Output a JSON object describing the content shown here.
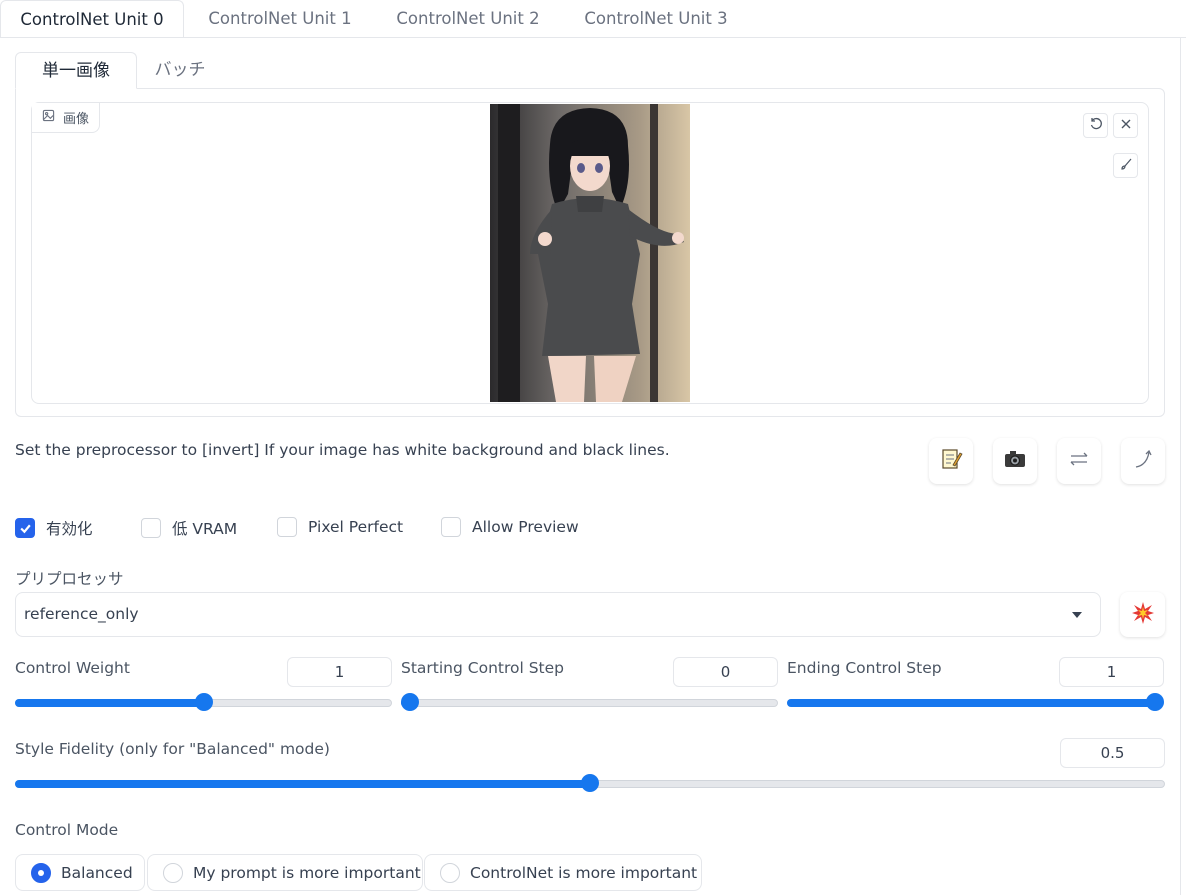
{
  "unit_tabs": [
    {
      "label": "ControlNet Unit 0",
      "active": true
    },
    {
      "label": "ControlNet Unit 1",
      "active": false
    },
    {
      "label": "ControlNet Unit 2",
      "active": false
    },
    {
      "label": "ControlNet Unit 3",
      "active": false
    }
  ],
  "mode_tabs": [
    {
      "label": "単一画像",
      "active": true
    },
    {
      "label": "バッチ",
      "active": false
    }
  ],
  "image_panel": {
    "label": "画像",
    "icons": [
      "undo-icon",
      "close-icon",
      "brush-icon"
    ]
  },
  "hint_text": "Set the preprocessor to [invert] If your image has white background and black lines.",
  "action_buttons": [
    "notepad-icon",
    "camera-icon",
    "swap-icon",
    "send-arrow-icon"
  ],
  "checkboxes": [
    {
      "label": "有効化",
      "checked": true
    },
    {
      "label": "低 VRAM",
      "checked": false
    },
    {
      "label": "Pixel Perfect",
      "checked": false
    },
    {
      "label": "Allow Preview",
      "checked": false
    }
  ],
  "preprocessor": {
    "label": "プリプロセッサ",
    "value": "reference_only",
    "run_icon": "explosion-icon"
  },
  "sliders": {
    "control_weight": {
      "label": "Control Weight",
      "value": "1",
      "min": 0,
      "max": 2,
      "current": 1
    },
    "starting_step": {
      "label": "Starting Control Step",
      "value": "0",
      "min": 0,
      "max": 1,
      "current": 0
    },
    "ending_step": {
      "label": "Ending Control Step",
      "value": "1",
      "min": 0,
      "max": 1,
      "current": 1
    },
    "style_fidelity": {
      "label": "Style Fidelity (only for \"Balanced\" mode)",
      "value": "0.5",
      "min": 0,
      "max": 1,
      "current": 0.5
    }
  },
  "control_mode": {
    "label": "Control Mode",
    "options": [
      {
        "label": "Balanced",
        "selected": true
      },
      {
        "label": "My prompt is more important",
        "selected": false
      },
      {
        "label": "ControlNet is more important",
        "selected": false
      }
    ]
  },
  "colors": {
    "accent": "#1677ee",
    "checkbox_accent": "#2563eb",
    "border": "#e5e7eb",
    "text": "#374151"
  }
}
